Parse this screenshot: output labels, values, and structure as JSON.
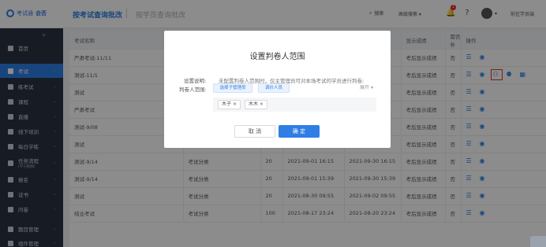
{
  "header": {
    "brand_tag": "考试通",
    "brand_app": "会否",
    "tabs": [
      "按考试查询批改",
      "按学员查询批改"
    ],
    "search_label": "搜索",
    "advanced_search_label": "高级搜索",
    "notification_count": "1",
    "user_name": "前往学员端"
  },
  "sidebar": {
    "items": [
      {
        "label": "首页",
        "sub": ""
      },
      {
        "label": "考试",
        "sub": ""
      },
      {
        "label": "练考试",
        "sub": ""
      },
      {
        "label": "课程",
        "sub": ""
      },
      {
        "label": "直播",
        "sub": ""
      },
      {
        "label": "线下培训",
        "sub": ""
      },
      {
        "label": "每日学练",
        "sub": ""
      },
      {
        "label": "任务流程",
        "sub": "(学习地图)"
      },
      {
        "label": "报名",
        "sub": ""
      },
      {
        "label": "证书",
        "sub": ""
      },
      {
        "label": "问卷",
        "sub": ""
      },
      {
        "label": "题目管理",
        "sub": ""
      },
      {
        "label": "组件管理",
        "sub": ""
      }
    ]
  },
  "table": {
    "columns": [
      "考试名称",
      "",
      "",
      "",
      "",
      "显示成绩",
      "需否补",
      "操作"
    ],
    "rows": [
      [
        "严肃考试-11/11",
        "",
        "",
        "",
        "",
        "考后显示成绩",
        "否"
      ],
      [
        "测试-11/1",
        "",
        "",
        "",
        "",
        "考后显示成绩",
        "否"
      ],
      [
        "测试",
        "",
        "",
        "",
        "",
        "考后显示成绩",
        "否"
      ],
      [
        "严肃考试",
        "",
        "",
        "",
        "",
        "考后显示成绩",
        "否"
      ],
      [
        "测试-9/08",
        "",
        "",
        "",
        "",
        "考后显示成绩",
        "否"
      ],
      [
        "测试",
        "",
        "",
        "2021-09-04 15:02",
        "",
        "考后显示成绩",
        "否"
      ],
      [
        "测试-9/14",
        "考试分类",
        "20",
        "2021-09-01 16:15",
        "2021-09-30 16:15",
        "考后显示成绩",
        "否"
      ],
      [
        "测试-9/14",
        "考试分类",
        "20",
        "2021-09-01 15:39",
        "2021-09-30 15:39",
        "考后显示成绩",
        "否"
      ],
      [
        "测试",
        "考试分类",
        "20",
        "2021-08-30 09:55",
        "2021-09-02 09:55",
        "考后显示成绩",
        "否"
      ],
      [
        "结业考试",
        "考试分类",
        "100",
        "2021-08-17 23:24",
        "2021-08-20 23:24",
        "考后显示成绩",
        "否"
      ]
    ]
  },
  "modal": {
    "title": "设置判卷人范围",
    "desc_label": "设置说明:",
    "desc_text": "未配置判卷人范围时，仅主管理员可对本场考试的学员进行判卷;",
    "scope_label": "判卷人范围:",
    "select_admin_label": "选择子管理员",
    "add_person_label": "调价人员",
    "expand_label": "展开",
    "chips": [
      "木子",
      "木木"
    ],
    "cancel_label": "取 消",
    "confirm_label": "确 定"
  },
  "colors": {
    "accent": "#2f7ee6",
    "sidebar_bg": "#2b3443",
    "highlight": "#e8312a"
  }
}
